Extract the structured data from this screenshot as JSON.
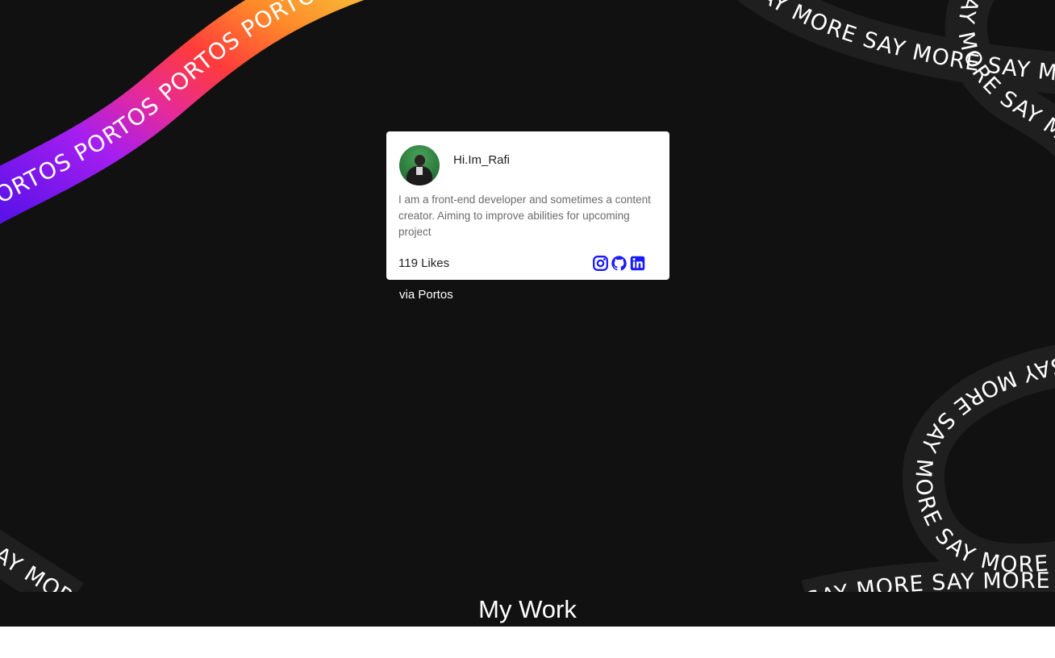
{
  "background": {
    "color": "#111111",
    "ribbon_rainbow_text": "PORTOS PORTOS PORTOS PORTOS PORTOS",
    "ribbon_say_more_text": "SAY MORE SAY MORE SAY MORE SAY MORE SAY MORE SAY MORE"
  },
  "profile_card": {
    "name": "Hi.Im_Rafi",
    "bio": "I am a front-end developer and sometimes a content creator. Aiming to improve abilities for upcoming project",
    "likes": "119 Likes",
    "social_icons": [
      "instagram-icon",
      "github-icon",
      "linkedin-icon"
    ],
    "icon_color": "#1a1aff"
  },
  "via_text": "via Portos",
  "section_title": "My Work"
}
